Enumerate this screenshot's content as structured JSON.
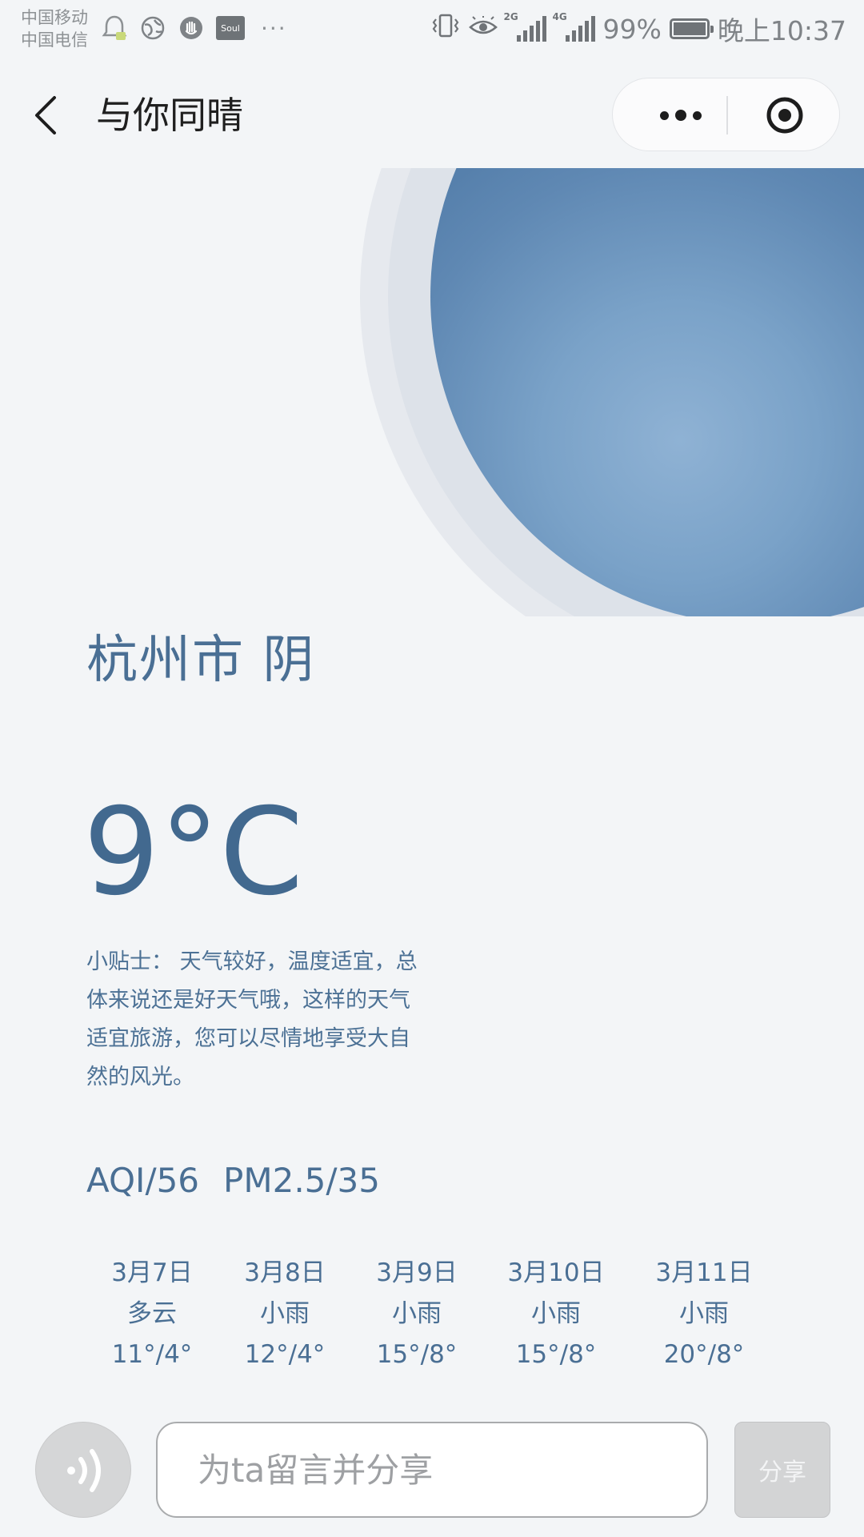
{
  "status_bar": {
    "carrier_1": "中国移动",
    "carrier_2": "中国电信",
    "soul_label": "Soul",
    "more_dots": "···",
    "network_1": "2G",
    "network_2": "4G",
    "battery_text": "99%",
    "battery_level": 0.99,
    "time": "晚上10:37",
    "icons": [
      "notification-bell-icon",
      "globe-icon",
      "hand-icon",
      "soul-app-icon",
      "vibrate-icon",
      "eye-icon",
      "signal-icon",
      "battery-icon"
    ]
  },
  "nav": {
    "title": "与你同晴",
    "icons": [
      "back-arrow-icon",
      "more-dots-icon",
      "close-target-icon"
    ]
  },
  "weather": {
    "city_condition": "杭州市 阴",
    "temperature": "9°C",
    "tip": "小贴士： 天气较好，温度适宜，总体来说还是好天气哦，这样的天气适宜旅游，您可以尽情地享受大自然的风光。",
    "aqi": "AQI/56",
    "pm25": "PM2.5/35"
  },
  "forecast": [
    {
      "date": "3月7日",
      "condition": "多云",
      "temp": "11°/4°"
    },
    {
      "date": "3月8日",
      "condition": "小雨",
      "temp": "12°/4°"
    },
    {
      "date": "3月9日",
      "condition": "小雨",
      "temp": "15°/8°"
    },
    {
      "date": "3月10日",
      "condition": "小雨",
      "temp": "15°/8°"
    },
    {
      "date": "3月11日",
      "condition": "小雨",
      "temp": "20°/8°"
    }
  ],
  "bottom_bar": {
    "input_placeholder": "为ta留言并分享",
    "share_label": "分享",
    "icons": [
      "voice-icon"
    ]
  },
  "colors": {
    "accent": "#4a6f94",
    "orb": "#44709e",
    "background": "#f3f5f7"
  }
}
